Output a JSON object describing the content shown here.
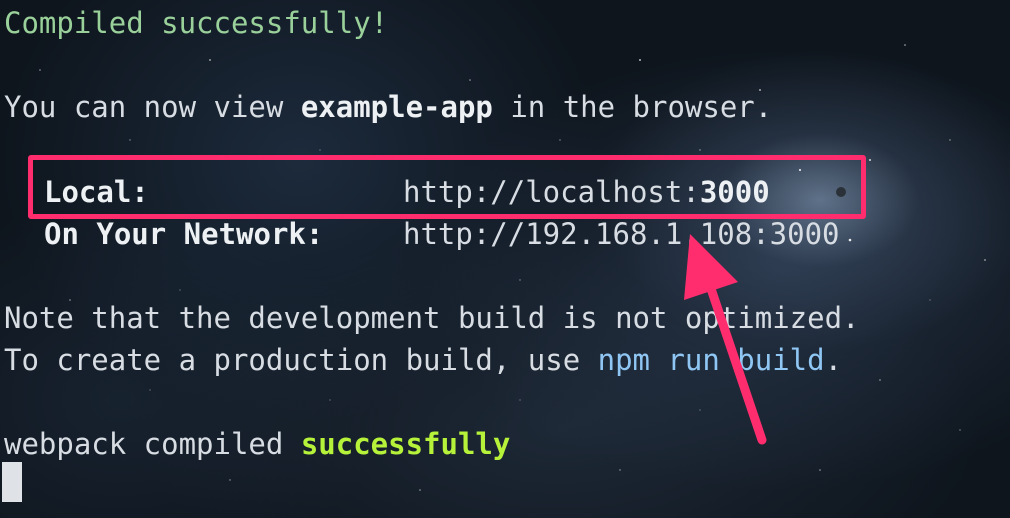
{
  "terminal": {
    "compiled_message": "Compiled successfully!",
    "view_prefix": "You can now view ",
    "app_name": "example-app",
    "view_suffix": " in the browser.",
    "local_label": "Local:",
    "local_url_prefix": "http://localhost:",
    "local_port": "3000",
    "network_label": "On Your Network:",
    "network_url": "http://192.168.1.108:3000",
    "note_line": "Note that the development build is not optimized.",
    "production_prefix": "To create a production build, use ",
    "production_command": "npm run build",
    "production_suffix": ".",
    "webpack_prefix": "webpack compiled ",
    "webpack_status": "successfully"
  },
  "colors": {
    "success_green": "#9ad09a",
    "webpack_green": "#b6f23a",
    "command_blue": "#8fc6f3",
    "annotation_pink": "#ff2d6e",
    "background": "#0e151d"
  },
  "annotation": {
    "box_target": "local-url-row",
    "arrow_icon": "arrow-up-icon"
  }
}
